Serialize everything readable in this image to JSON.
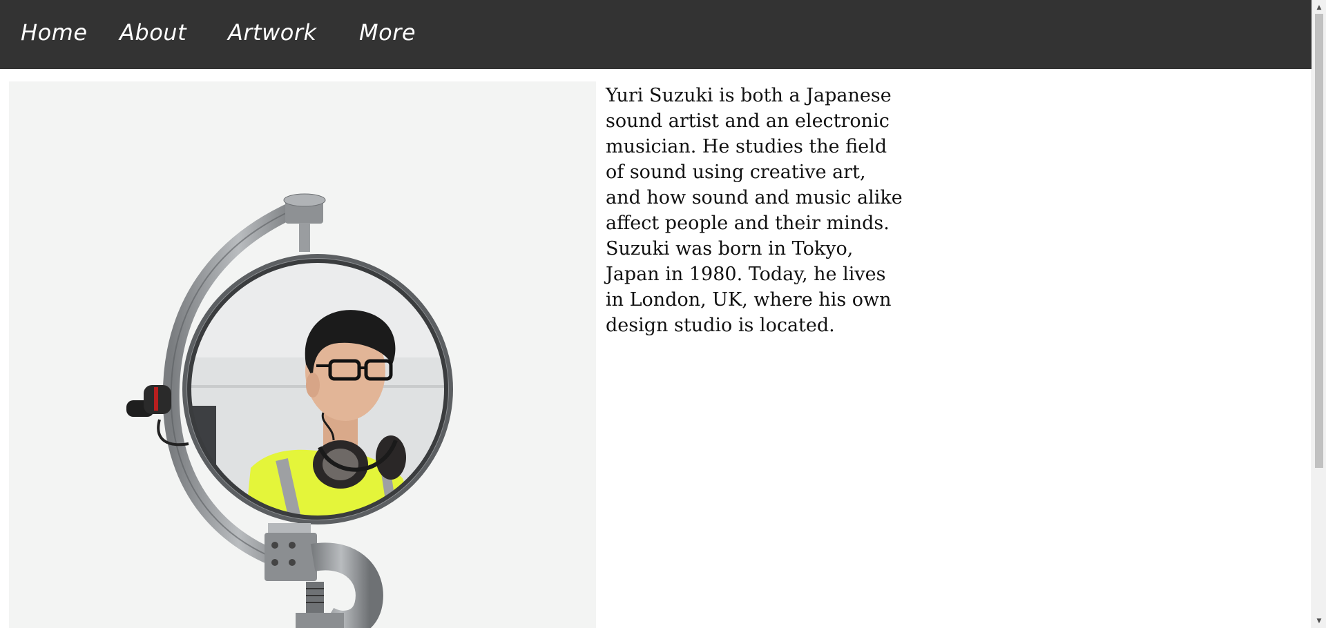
{
  "nav": {
    "items": [
      {
        "label": "Home"
      },
      {
        "label": "About"
      },
      {
        "label": "Artwork"
      },
      {
        "label": "More"
      }
    ]
  },
  "main": {
    "photo_icon": "portrait-photo-icon",
    "bio": "Yuri Suzuki is both a Japanese sound artist and an electronic musician. He studies the field of sound using creative art, and how sound and music alike affect people and their minds. Suzuki was born in Tokyo, Japan in 1980. Today, he lives in London, UK, where his own design studio is located."
  },
  "colors": {
    "navbar": "#333333",
    "nav_text": "#ffffff",
    "jacket": "#e4f53a"
  },
  "scrollbar": {
    "up_icon": "scroll-up-arrow-icon",
    "down_icon": "scroll-down-arrow-icon"
  }
}
